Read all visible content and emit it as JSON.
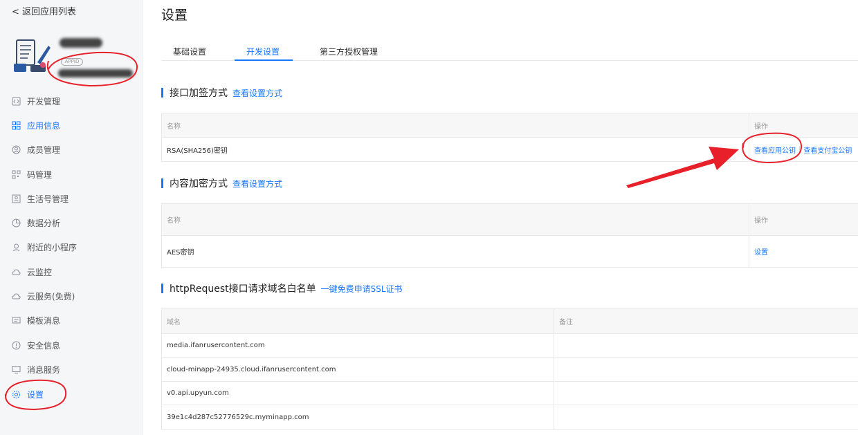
{
  "sidebar": {
    "back_label": "< 返回应用列表",
    "appid_badge": "APPID",
    "items": [
      {
        "label": "开发管理",
        "icon": "code-icon"
      },
      {
        "label": "应用信息",
        "icon": "grid-icon"
      },
      {
        "label": "成员管理",
        "icon": "user-icon"
      },
      {
        "label": "码管理",
        "icon": "qrcode-icon"
      },
      {
        "label": "生活号管理",
        "icon": "profile-icon"
      },
      {
        "label": "数据分析",
        "icon": "pie-chart-icon"
      },
      {
        "label": "附近的小程序",
        "icon": "location-icon"
      },
      {
        "label": "云监控",
        "icon": "cloud-icon"
      },
      {
        "label": "云服务(免费)",
        "icon": "cloud-icon"
      },
      {
        "label": "模板消息",
        "icon": "message-icon"
      },
      {
        "label": "安全信息",
        "icon": "alert-icon"
      },
      {
        "label": "消息服务",
        "icon": "monitor-icon"
      },
      {
        "label": "设置",
        "icon": "gear-icon"
      }
    ]
  },
  "main": {
    "title": "设置",
    "tabs": [
      {
        "label": "基础设置"
      },
      {
        "label": "开发设置"
      },
      {
        "label": "第三方授权管理"
      }
    ],
    "sign_section": {
      "title": "接口加签方式",
      "link": "查看设置方式",
      "col_name": "名称",
      "col_action": "操作",
      "row_name": "RSA(SHA256)密钥",
      "action_app_key": "查看应用公钥",
      "action_alipay_key": "查看支付宝公钥"
    },
    "encrypt_section": {
      "title": "内容加密方式",
      "link": "查看设置方式",
      "col_name": "名称",
      "col_action": "操作",
      "row_name": "AES密钥",
      "action_set": "设置"
    },
    "domain_section": {
      "title": "httpRequest接口请求域名白名单",
      "link": "一键免费申请SSL证书",
      "col_domain": "域名",
      "col_note": "备注",
      "domains": [
        "media.ifanrusercontent.com",
        "cloud-minapp-24935.cloud.ifanrusercontent.com",
        "v0.api.upyun.com",
        "39e1c4d287c52776529c.myminapp.com"
      ]
    }
  },
  "colors": {
    "accent": "#1677ff",
    "annotation": "#e8202a"
  }
}
